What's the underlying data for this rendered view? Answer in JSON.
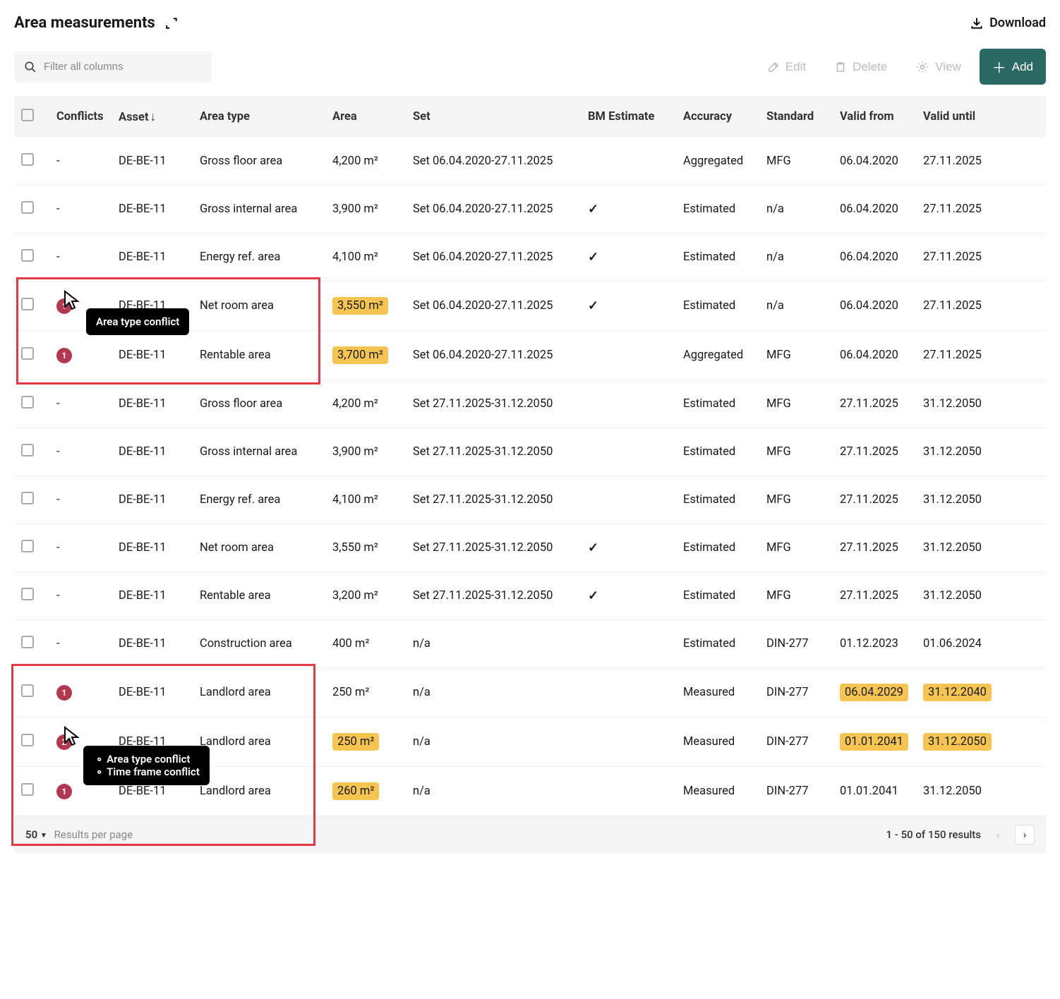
{
  "header": {
    "title": "Area measurements",
    "download_label": "Download"
  },
  "toolbar": {
    "filter_placeholder": "Filter all columns",
    "edit_label": "Edit",
    "delete_label": "Delete",
    "view_label": "View",
    "add_label": "Add"
  },
  "columns": {
    "conflicts": "Conflicts",
    "asset": "Asset",
    "area_type": "Area type",
    "area": "Area",
    "set": "Set",
    "bm_estimate": "BM Estimate",
    "accuracy": "Accuracy",
    "standard": "Standard",
    "valid_from": "Valid from",
    "valid_until": "Valid until"
  },
  "rows": [
    {
      "conflicts": "-",
      "asset": "DE-BE-11",
      "area_type": "Gross floor area",
      "area": "4,200 m²",
      "area_hl": false,
      "set": "Set 06.04.2020-27.11.2025",
      "bm": false,
      "accuracy": "Aggregated",
      "standard": "MFG",
      "valid_from": "06.04.2020",
      "vf_hl": false,
      "valid_until": "27.11.2025",
      "vu_hl": false
    },
    {
      "conflicts": "-",
      "asset": "DE-BE-11",
      "area_type": "Gross internal area",
      "area": "3,900 m²",
      "area_hl": false,
      "set": "Set 06.04.2020-27.11.2025",
      "bm": true,
      "accuracy": "Estimated",
      "standard": "n/a",
      "valid_from": "06.04.2020",
      "vf_hl": false,
      "valid_until": "27.11.2025",
      "vu_hl": false
    },
    {
      "conflicts": "-",
      "asset": "DE-BE-11",
      "area_type": "Energy ref. area",
      "area": "4,100 m²",
      "area_hl": false,
      "set": "Set 06.04.2020-27.11.2025",
      "bm": true,
      "accuracy": "Estimated",
      "standard": "n/a",
      "valid_from": "06.04.2020",
      "vf_hl": false,
      "valid_until": "27.11.2025",
      "vu_hl": false
    },
    {
      "conflicts": "1",
      "asset": "DE-BE-11",
      "area_type": "Net room area",
      "area": "3,550 m²",
      "area_hl": true,
      "set": "Set 06.04.2020-27.11.2025",
      "bm": true,
      "accuracy": "Estimated",
      "standard": "n/a",
      "valid_from": "06.04.2020",
      "vf_hl": false,
      "valid_until": "27.11.2025",
      "vu_hl": false
    },
    {
      "conflicts": "1",
      "asset": "DE-BE-11",
      "area_type": "Rentable area",
      "area": "3,700 m²",
      "area_hl": true,
      "set": "Set 06.04.2020-27.11.2025",
      "bm": false,
      "accuracy": "Aggregated",
      "standard": "MFG",
      "valid_from": "06.04.2020",
      "vf_hl": false,
      "valid_until": "27.11.2025",
      "vu_hl": false
    },
    {
      "conflicts": "-",
      "asset": "DE-BE-11",
      "area_type": "Gross floor area",
      "area": "4,200 m²",
      "area_hl": false,
      "set": "Set 27.11.2025-31.12.2050",
      "bm": false,
      "accuracy": "Estimated",
      "standard": "MFG",
      "valid_from": "27.11.2025",
      "vf_hl": false,
      "valid_until": "31.12.2050",
      "vu_hl": false
    },
    {
      "conflicts": "-",
      "asset": "DE-BE-11",
      "area_type": "Gross internal area",
      "area": "3,900 m²",
      "area_hl": false,
      "set": "Set 27.11.2025-31.12.2050",
      "bm": false,
      "accuracy": "Estimated",
      "standard": "MFG",
      "valid_from": "27.11.2025",
      "vf_hl": false,
      "valid_until": "31.12.2050",
      "vu_hl": false
    },
    {
      "conflicts": "-",
      "asset": "DE-BE-11",
      "area_type": "Energy ref. area",
      "area": "4,100 m²",
      "area_hl": false,
      "set": "Set 27.11.2025-31.12.2050",
      "bm": false,
      "accuracy": "Estimated",
      "standard": "MFG",
      "valid_from": "27.11.2025",
      "vf_hl": false,
      "valid_until": "31.12.2050",
      "vu_hl": false
    },
    {
      "conflicts": "-",
      "asset": "DE-BE-11",
      "area_type": "Net room area",
      "area": "3,550 m²",
      "area_hl": false,
      "set": "Set 27.11.2025-31.12.2050",
      "bm": true,
      "accuracy": "Estimated",
      "standard": "MFG",
      "valid_from": "27.11.2025",
      "vf_hl": false,
      "valid_until": "31.12.2050",
      "vu_hl": false
    },
    {
      "conflicts": "-",
      "asset": "DE-BE-11",
      "area_type": "Rentable area",
      "area": "3,200 m²",
      "area_hl": false,
      "set": "Set 27.11.2025-31.12.2050",
      "bm": true,
      "accuracy": "Estimated",
      "standard": "MFG",
      "valid_from": "27.11.2025",
      "vf_hl": false,
      "valid_until": "31.12.2050",
      "vu_hl": false
    },
    {
      "conflicts": "-",
      "asset": "DE-BE-11",
      "area_type": "Construction area",
      "area": "400 m²",
      "area_hl": false,
      "set": "n/a",
      "bm": false,
      "accuracy": "Estimated",
      "standard": "DIN-277",
      "valid_from": "01.12.2023",
      "vf_hl": false,
      "valid_until": "01.06.2024",
      "vu_hl": false
    },
    {
      "conflicts": "1",
      "asset": "DE-BE-11",
      "area_type": "Landlord area",
      "area": "250 m²",
      "area_hl": false,
      "set": "n/a",
      "bm": false,
      "accuracy": "Measured",
      "standard": "DIN-277",
      "valid_from": "06.04.2029",
      "vf_hl": true,
      "valid_until": "31.12.2040",
      "vu_hl": true
    },
    {
      "conflicts": "2",
      "asset": "DE-BE-11",
      "area_type": "Landlord area",
      "area": "250 m²",
      "area_hl": true,
      "set": "n/a",
      "bm": false,
      "accuracy": "Measured",
      "standard": "DIN-277",
      "valid_from": "01.01.2041",
      "vf_hl": true,
      "valid_until": "31.12.2050",
      "vu_hl": true
    },
    {
      "conflicts": "1",
      "asset": "DE-BE-11",
      "area_type": "Landlord area",
      "area": "260 m²",
      "area_hl": true,
      "set": "n/a",
      "bm": false,
      "accuracy": "Measured",
      "standard": "DIN-277",
      "valid_from": "01.01.2041",
      "vf_hl": false,
      "valid_until": "31.12.2050",
      "vu_hl": false
    }
  ],
  "tooltips": {
    "single": "Area type conflict",
    "multi": [
      "Area type conflict",
      "Time frame conflict"
    ]
  },
  "footer": {
    "per_page": "50",
    "per_page_label": "Results per page",
    "results_text": "1 - 50 of 150 results"
  }
}
